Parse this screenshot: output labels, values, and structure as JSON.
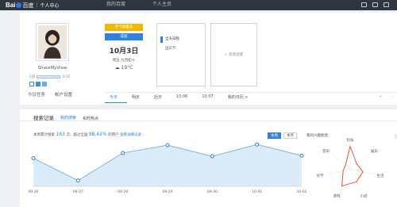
{
  "header": {
    "logo_bai": "Bai",
    "logo_du": "百度",
    "logo_sep": "|",
    "center_label": "个人中心",
    "nav": [
      "我的百度",
      "个人主页"
    ],
    "icons": [
      "message-icon",
      "settings-icon",
      "user-icon"
    ]
  },
  "profile": {
    "username": "ShareMyView",
    "level_label": "1级",
    "level_value": "0/30",
    "tabs": [
      "今日任务",
      "帐户设置"
    ]
  },
  "calendar": {
    "btn_yellow": "空气质量良",
    "btn_blue": "成就",
    "date": "10月3日",
    "week_lunar": "周五  九月初十",
    "weather": "19°C",
    "weather_icon": "cloud-icon",
    "schedule_title": "全天日程",
    "schedule_item": "国庆节",
    "add_label": "+ 新建提醒",
    "day_tabs": [
      "今天",
      "明天",
      "后天",
      "10.06",
      "10.07",
      "我的日历 >"
    ],
    "plus_label": "+",
    "more_label": "···"
  },
  "search_panel": {
    "title": "搜索记录",
    "tabs": [
      "我的搜索",
      "实时热点"
    ],
    "stat_prefix": "本周累计搜索",
    "stat_count": "163",
    "stat_mid": "次，超过全国",
    "stat_percent": "98.42%",
    "stat_suffix": "的用户",
    "stat_link": "查看详细记录 ›",
    "range_tabs": [
      "本周",
      "本月"
    ],
    "interest_label": "我的兴趣图谱：",
    "colors": {
      "accent": "#2e82e0",
      "area": "#dcebf8",
      "radar": "#e05a2b"
    }
  },
  "chart_data": {
    "type": "area",
    "categories": [
      "09-26",
      "09-27",
      "09-28",
      "09-29",
      "09-30",
      "10-01",
      "10-02"
    ],
    "values": [
      43,
      9,
      51,
      63,
      46,
      64,
      47
    ],
    "ylim": [
      0,
      80
    ],
    "grid": false,
    "legend": "none"
  },
  "radar": {
    "labels": [
      "科技",
      "娱乐",
      "生活",
      "小说",
      "游戏",
      "文学",
      "音乐"
    ]
  }
}
